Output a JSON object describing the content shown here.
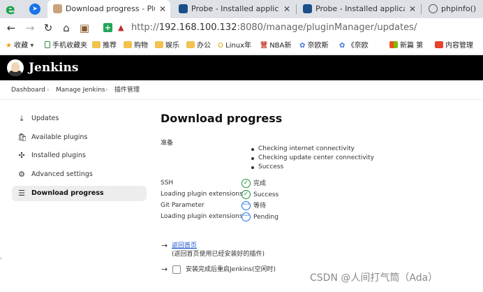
{
  "browser": {
    "tabs": [
      {
        "label": "Download progress - Plugi",
        "active": true
      },
      {
        "label": "Probe - Installed applicatio",
        "active": false
      },
      {
        "label": "Probe - Installed applicatio",
        "active": false
      },
      {
        "label": "phpinfo()",
        "active": false
      }
    ],
    "url": {
      "prefix": "http://",
      "host": "192.168.100.132",
      "rest": ":8080/manage/pluginManager/updates/"
    },
    "bookmarks": [
      "收藏",
      "手机收藏夹",
      "推荐",
      "购物",
      "娱乐",
      "办公",
      "Linux年",
      "NBA新",
      "奈欧斯",
      "《奈欧",
      "新篇 第",
      "内容管理"
    ]
  },
  "jenkins": {
    "title": "Jenkins",
    "breadcrumbs": [
      "Dashboard",
      "Manage Jenkins",
      "插件管理"
    ]
  },
  "sidebar": {
    "items": [
      {
        "label": "Updates",
        "icon": "download-icon",
        "glyph": "⤓",
        "active": false
      },
      {
        "label": "Available plugins",
        "icon": "shopping-bag-icon",
        "glyph": "🛍",
        "active": false
      },
      {
        "label": "Installed plugins",
        "icon": "puzzle-icon",
        "glyph": "✣",
        "active": false
      },
      {
        "label": "Advanced settings",
        "icon": "gear-icon",
        "glyph": "⚙",
        "active": false
      },
      {
        "label": "Download progress",
        "icon": "list-icon",
        "glyph": "☰",
        "active": true
      }
    ]
  },
  "main": {
    "title": "Download progress",
    "prep_label": "准备",
    "prep_items": [
      "Checking internet connectivity",
      "Checking update center connectivity",
      "Success"
    ],
    "plugins": [
      {
        "name": "SSH",
        "status": "完成",
        "state": "done"
      },
      {
        "name": "Loading plugin extensions",
        "status": "Success",
        "state": "done"
      },
      {
        "name": "Git Parameter",
        "status": "等待",
        "state": "pending"
      },
      {
        "name": "Loading plugin extensions",
        "status": "Pending",
        "state": "pending"
      }
    ],
    "back_link": "返回首页",
    "back_note": "(返回首页使用已经安装好的插件)",
    "restart_label": "安装完成后重启Jenkins(空闲时)"
  },
  "watermark": "CSDN @人间打气筒（Ada）",
  "colors": {
    "success": "#1e8e3e",
    "pending": "#1a73e8",
    "header": "#000000",
    "link": "#1a55c9"
  }
}
